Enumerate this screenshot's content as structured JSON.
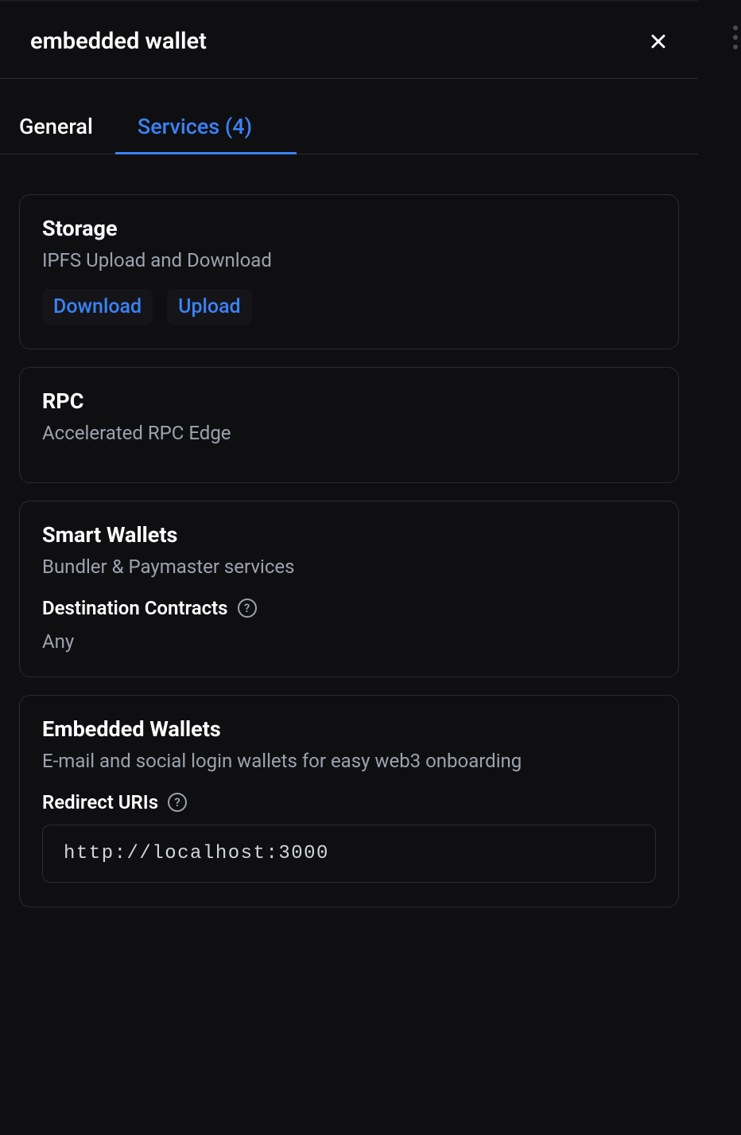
{
  "header": {
    "title": "embedded wallet"
  },
  "tabs": {
    "general": "General",
    "services": "Services (4)"
  },
  "cards": {
    "storage": {
      "title": "Storage",
      "subtitle": "IPFS Upload and Download",
      "chips": {
        "download": "Download",
        "upload": "Upload"
      }
    },
    "rpc": {
      "title": "RPC",
      "subtitle": "Accelerated RPC Edge"
    },
    "smartWallets": {
      "title": "Smart Wallets",
      "subtitle": "Bundler & Paymaster services",
      "sectionLabel": "Destination Contracts",
      "sectionValue": "Any"
    },
    "embeddedWallets": {
      "title": "Embedded Wallets",
      "subtitle": "E-mail and social login wallets for easy web3 onboarding",
      "sectionLabel": "Redirect URIs",
      "uri": "http://localhost:3000"
    }
  }
}
